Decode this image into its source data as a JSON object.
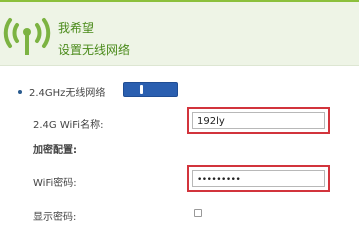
{
  "header": {
    "title": "我希望",
    "subtitle": "设置无线网络"
  },
  "wifi_section": {
    "band_label": "2.4GHz无线网络",
    "toggle_state": "on",
    "ssid_label": "2.4G WiFi名称:",
    "ssid_value": "192ly",
    "security_heading": "加密配置:",
    "password_label": "WiFi密码:",
    "password_value": "•••••••••",
    "show_password_label": "显示密码:",
    "show_password_checked": false
  },
  "colors": {
    "accent": "#8cc03c",
    "header_bg": "#eef4e6",
    "header_text": "#4a8a1a",
    "highlight_red": "#d2343c",
    "toggle_blue": "#2a5fb0"
  },
  "icons": {
    "header": "wifi-signal-icon"
  }
}
